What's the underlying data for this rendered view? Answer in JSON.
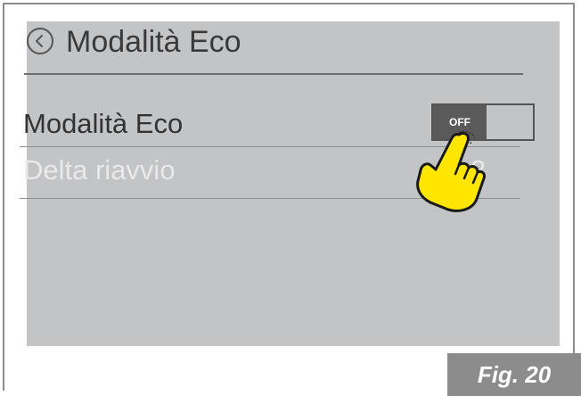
{
  "header": {
    "title": "Modalità Eco"
  },
  "settings": {
    "items": [
      {
        "label": "Modalità Eco",
        "toggle_state": "OFF"
      },
      {
        "label": "Delta riavvio",
        "value": "2"
      }
    ]
  },
  "figure": {
    "label": "Fig. 20"
  },
  "icons": {
    "back": "chevron-left-circle-icon",
    "hand": "pointing-hand-icon"
  },
  "colors": {
    "screen_bg": "#c3c4c6",
    "toggle_knob": "#5a5a5a",
    "hand": "#ffe600",
    "fig_label_bg": "#8c8c8c"
  }
}
